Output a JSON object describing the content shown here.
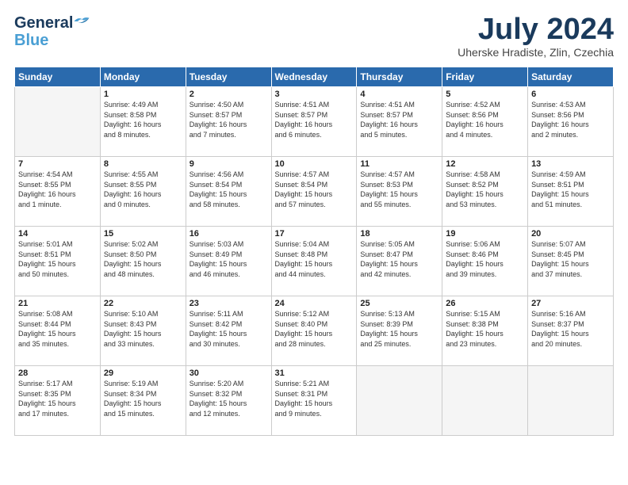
{
  "header": {
    "logo_general": "General",
    "logo_blue": "Blue",
    "month_title": "July 2024",
    "subtitle": "Uherske Hradiste, Zlin, Czechia"
  },
  "columns": [
    "Sunday",
    "Monday",
    "Tuesday",
    "Wednesday",
    "Thursday",
    "Friday",
    "Saturday"
  ],
  "weeks": [
    [
      {
        "day": "",
        "info": ""
      },
      {
        "day": "1",
        "info": "Sunrise: 4:49 AM\nSunset: 8:58 PM\nDaylight: 16 hours\nand 8 minutes."
      },
      {
        "day": "2",
        "info": "Sunrise: 4:50 AM\nSunset: 8:57 PM\nDaylight: 16 hours\nand 7 minutes."
      },
      {
        "day": "3",
        "info": "Sunrise: 4:51 AM\nSunset: 8:57 PM\nDaylight: 16 hours\nand 6 minutes."
      },
      {
        "day": "4",
        "info": "Sunrise: 4:51 AM\nSunset: 8:57 PM\nDaylight: 16 hours\nand 5 minutes."
      },
      {
        "day": "5",
        "info": "Sunrise: 4:52 AM\nSunset: 8:56 PM\nDaylight: 16 hours\nand 4 minutes."
      },
      {
        "day": "6",
        "info": "Sunrise: 4:53 AM\nSunset: 8:56 PM\nDaylight: 16 hours\nand 2 minutes."
      }
    ],
    [
      {
        "day": "7",
        "info": "Sunrise: 4:54 AM\nSunset: 8:55 PM\nDaylight: 16 hours\nand 1 minute."
      },
      {
        "day": "8",
        "info": "Sunrise: 4:55 AM\nSunset: 8:55 PM\nDaylight: 16 hours\nand 0 minutes."
      },
      {
        "day": "9",
        "info": "Sunrise: 4:56 AM\nSunset: 8:54 PM\nDaylight: 15 hours\nand 58 minutes."
      },
      {
        "day": "10",
        "info": "Sunrise: 4:57 AM\nSunset: 8:54 PM\nDaylight: 15 hours\nand 57 minutes."
      },
      {
        "day": "11",
        "info": "Sunrise: 4:57 AM\nSunset: 8:53 PM\nDaylight: 15 hours\nand 55 minutes."
      },
      {
        "day": "12",
        "info": "Sunrise: 4:58 AM\nSunset: 8:52 PM\nDaylight: 15 hours\nand 53 minutes."
      },
      {
        "day": "13",
        "info": "Sunrise: 4:59 AM\nSunset: 8:51 PM\nDaylight: 15 hours\nand 51 minutes."
      }
    ],
    [
      {
        "day": "14",
        "info": "Sunrise: 5:01 AM\nSunset: 8:51 PM\nDaylight: 15 hours\nand 50 minutes."
      },
      {
        "day": "15",
        "info": "Sunrise: 5:02 AM\nSunset: 8:50 PM\nDaylight: 15 hours\nand 48 minutes."
      },
      {
        "day": "16",
        "info": "Sunrise: 5:03 AM\nSunset: 8:49 PM\nDaylight: 15 hours\nand 46 minutes."
      },
      {
        "day": "17",
        "info": "Sunrise: 5:04 AM\nSunset: 8:48 PM\nDaylight: 15 hours\nand 44 minutes."
      },
      {
        "day": "18",
        "info": "Sunrise: 5:05 AM\nSunset: 8:47 PM\nDaylight: 15 hours\nand 42 minutes."
      },
      {
        "day": "19",
        "info": "Sunrise: 5:06 AM\nSunset: 8:46 PM\nDaylight: 15 hours\nand 39 minutes."
      },
      {
        "day": "20",
        "info": "Sunrise: 5:07 AM\nSunset: 8:45 PM\nDaylight: 15 hours\nand 37 minutes."
      }
    ],
    [
      {
        "day": "21",
        "info": "Sunrise: 5:08 AM\nSunset: 8:44 PM\nDaylight: 15 hours\nand 35 minutes."
      },
      {
        "day": "22",
        "info": "Sunrise: 5:10 AM\nSunset: 8:43 PM\nDaylight: 15 hours\nand 33 minutes."
      },
      {
        "day": "23",
        "info": "Sunrise: 5:11 AM\nSunset: 8:42 PM\nDaylight: 15 hours\nand 30 minutes."
      },
      {
        "day": "24",
        "info": "Sunrise: 5:12 AM\nSunset: 8:40 PM\nDaylight: 15 hours\nand 28 minutes."
      },
      {
        "day": "25",
        "info": "Sunrise: 5:13 AM\nSunset: 8:39 PM\nDaylight: 15 hours\nand 25 minutes."
      },
      {
        "day": "26",
        "info": "Sunrise: 5:15 AM\nSunset: 8:38 PM\nDaylight: 15 hours\nand 23 minutes."
      },
      {
        "day": "27",
        "info": "Sunrise: 5:16 AM\nSunset: 8:37 PM\nDaylight: 15 hours\nand 20 minutes."
      }
    ],
    [
      {
        "day": "28",
        "info": "Sunrise: 5:17 AM\nSunset: 8:35 PM\nDaylight: 15 hours\nand 17 minutes."
      },
      {
        "day": "29",
        "info": "Sunrise: 5:19 AM\nSunset: 8:34 PM\nDaylight: 15 hours\nand 15 minutes."
      },
      {
        "day": "30",
        "info": "Sunrise: 5:20 AM\nSunset: 8:32 PM\nDaylight: 15 hours\nand 12 minutes."
      },
      {
        "day": "31",
        "info": "Sunrise: 5:21 AM\nSunset: 8:31 PM\nDaylight: 15 hours\nand 9 minutes."
      },
      {
        "day": "",
        "info": ""
      },
      {
        "day": "",
        "info": ""
      },
      {
        "day": "",
        "info": ""
      }
    ]
  ]
}
